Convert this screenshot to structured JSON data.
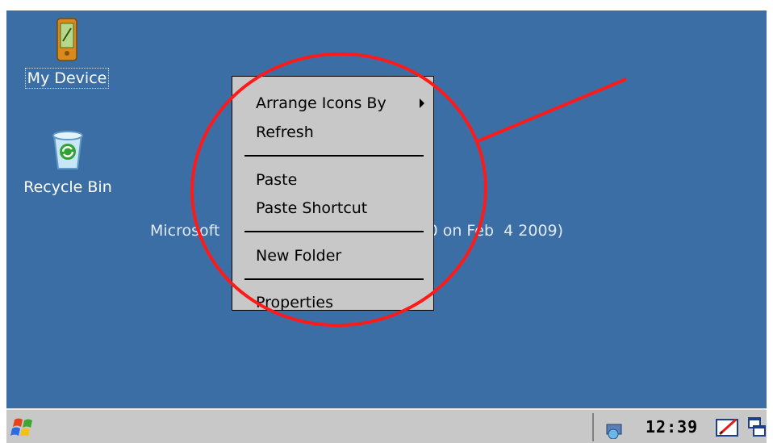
{
  "desktop": {
    "icons": [
      {
        "label": "My Device"
      },
      {
        "label": "Recycle Bin"
      }
    ],
    "build_text": "Microsoft                                    uild 0 on Feb  4 2009)"
  },
  "context_menu": {
    "items": [
      {
        "label": "Arrange Icons By",
        "submenu": true
      },
      {
        "label": "Refresh"
      },
      {
        "label": "Paste"
      },
      {
        "label": "Paste Shortcut"
      },
      {
        "label": "New Folder"
      },
      {
        "label": "Properties"
      }
    ]
  },
  "taskbar": {
    "clock": "12:39",
    "tray_icons": [
      "network-icon",
      "pen-input-icon",
      "windows-icon"
    ],
    "start_icon": "windows-flag-icon"
  },
  "colors": {
    "desktop_background": "#3a6ea5",
    "menu_background": "#c8c8c8",
    "annotation": "#ff0000"
  }
}
